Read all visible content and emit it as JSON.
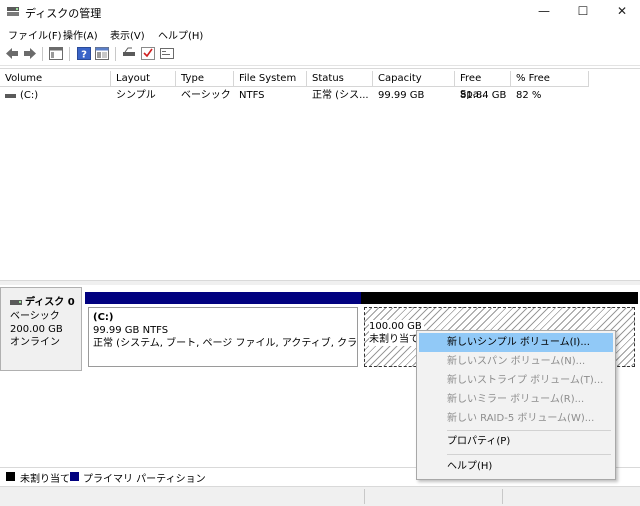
{
  "window": {
    "title": "ディスクの管理",
    "min_glyph": "—",
    "max_glyph": "☐",
    "close_glyph": "✕"
  },
  "menubar": [
    "ファイル(F)",
    "操作(A)",
    "表示(V)",
    "ヘルプ(H)"
  ],
  "toolbar": {
    "icons": [
      "back-arrow-icon",
      "forward-arrow-icon",
      "console-tree-icon",
      "help-icon",
      "properties-icon",
      "disk-icon",
      "check-icon",
      "console-icon"
    ]
  },
  "volume_list": {
    "columns": [
      "Volume",
      "Layout",
      "Type",
      "File System",
      "Status",
      "Capacity",
      "Free Spa...",
      "% Free"
    ],
    "rows": [
      [
        "(C:)",
        "シンプル",
        "ベーシック",
        "NTFS",
        "正常 (シス...",
        "99.99 GB",
        "81.84 GB",
        "82 %"
      ]
    ]
  },
  "disk": {
    "name": "ディスク 0",
    "type": "ベーシック",
    "size": "200.00 GB",
    "status": "オンライン",
    "partitions": [
      {
        "name": "(C:)",
        "size_fs": "99.99 GB NTFS",
        "status": "正常 (システム, ブート, ページ ファイル, アクティブ, クラッシュ ダンプ, プ",
        "bar_color": "#00007f"
      },
      {
        "size": "100.00 GB",
        "status": "未割り当て",
        "bar_color": "#000000"
      }
    ]
  },
  "legend": [
    {
      "label": "未割り当て",
      "color": "#000000"
    },
    {
      "label": "プライマリ パーティション",
      "color": "#00007f"
    }
  ],
  "context_menu": {
    "items": [
      {
        "label": "新しいシンプル ボリューム(I)...",
        "state": "highlighted"
      },
      {
        "label": "新しいスパン ボリューム(N)...",
        "state": "disabled"
      },
      {
        "label": "新しいストライプ ボリューム(T)...",
        "state": "disabled"
      },
      {
        "label": "新しいミラー ボリューム(R)...",
        "state": "disabled"
      },
      {
        "label": "新しい RAID-5 ボリューム(W)...",
        "state": "disabled"
      },
      {
        "label": "プロパティ(P)",
        "state": "enabled"
      },
      {
        "label": "ヘルプ(H)",
        "state": "enabled"
      }
    ]
  },
  "colors": {
    "accent_highlight": "#91c9f7",
    "primary_partition": "#00007f",
    "unallocated": "#000000"
  }
}
